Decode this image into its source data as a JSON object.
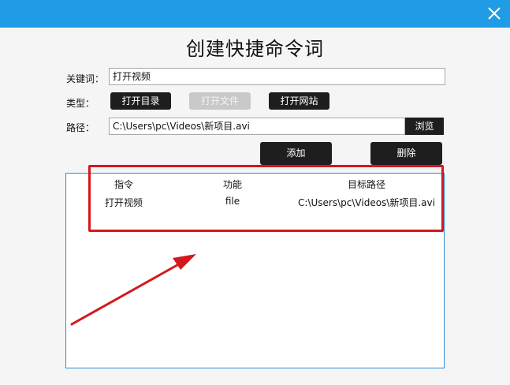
{
  "dialog": {
    "title": "创建快捷命令词"
  },
  "form": {
    "keyword_label": "关键词：",
    "keyword_value": "打开视频",
    "type_label": "类型：",
    "type_buttons": {
      "open_dir": "打开目录",
      "open_file": "打开文件",
      "open_site": "打开网站"
    },
    "path_label": "路径：",
    "path_value": "C:\\Users\\pc\\Videos\\新项目.avi",
    "browse": "浏览"
  },
  "actions": {
    "add": "添加",
    "delete": "删除"
  },
  "table": {
    "columns": [
      "指令",
      "功能",
      "目标路径"
    ],
    "rows": [
      [
        "打开视频",
        "file",
        "C:\\Users\\pc\\Videos\\新项目.avi"
      ]
    ]
  },
  "colors": {
    "titlebar": "#1f9ce5",
    "annotation": "#d3181e"
  },
  "icons": {
    "close": "close-icon"
  }
}
